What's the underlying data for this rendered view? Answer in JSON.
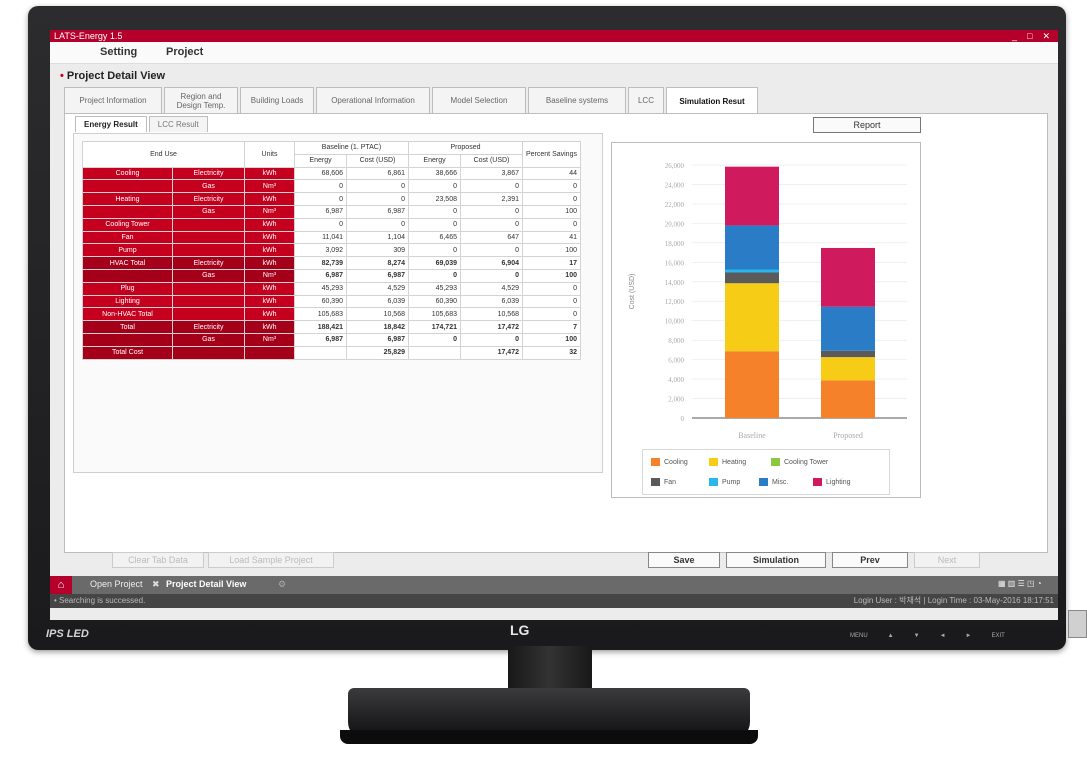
{
  "app": {
    "title": "LATS-Energy 1.5",
    "min": "_",
    "max": "□",
    "close": "✕"
  },
  "menu": [
    "Setting",
    "Project"
  ],
  "page_title": "Project Detail View",
  "tabs": [
    "Project Information",
    "Region and Design Temp.",
    "Building Loads",
    "Operational Information",
    "Model Selection",
    "Baseline systems",
    "LCC",
    "Simulation Resut"
  ],
  "subtabs": [
    "Energy Result",
    "LCC Result"
  ],
  "report_label": "Report",
  "table": {
    "h_enduse": "End Use",
    "h_units": "Units",
    "h_baseline": "Baseline (1. PTAC)",
    "h_proposed": "Proposed",
    "h_percent": "Percent Savings",
    "h_energy": "Energy",
    "h_cost": "Cost (USD)",
    "rows": [
      [
        "Cooling",
        "Electricity",
        "kWh",
        "68,606",
        "6,861",
        "38,666",
        "3,867",
        "44"
      ],
      [
        "",
        "Gas",
        "Nm³",
        "0",
        "0",
        "0",
        "0",
        "0"
      ],
      [
        "Heating",
        "Electricity",
        "kWh",
        "0",
        "0",
        "23,508",
        "2,391",
        "0"
      ],
      [
        "",
        "Gas",
        "Nm³",
        "6,987",
        "6,987",
        "0",
        "0",
        "100"
      ],
      [
        "Cooling Tower",
        "",
        "kWh",
        "0",
        "0",
        "0",
        "0",
        "0"
      ],
      [
        "Fan",
        "",
        "kWh",
        "11,041",
        "1,104",
        "6,465",
        "647",
        "41"
      ],
      [
        "Pump",
        "",
        "kWh",
        "3,092",
        "309",
        "0",
        "0",
        "100"
      ],
      [
        "HVAC Total",
        "Electricity",
        "kWh",
        "82,739",
        "8,274",
        "69,039",
        "6,904",
        "17"
      ],
      [
        "",
        "Gas",
        "Nm³",
        "6,987",
        "6,987",
        "0",
        "0",
        "100"
      ],
      [
        "Plug",
        "",
        "kWh",
        "45,293",
        "4,529",
        "45,293",
        "4,529",
        "0"
      ],
      [
        "Lighting",
        "",
        "kWh",
        "60,390",
        "6,039",
        "60,390",
        "6,039",
        "0"
      ],
      [
        "Non-HVAC Total",
        "",
        "kWh",
        "105,683",
        "10,568",
        "105,683",
        "10,568",
        "0"
      ],
      [
        "Total",
        "Electricity",
        "kWh",
        "188,421",
        "18,842",
        "174,721",
        "17,472",
        "7"
      ],
      [
        "",
        "Gas",
        "Nm³",
        "6,987",
        "6,987",
        "0",
        "0",
        "100"
      ],
      [
        "Total Cost",
        "",
        "",
        "",
        "25,829",
        "",
        "17,472",
        "32"
      ]
    ]
  },
  "chart_data": {
    "type": "bar",
    "stacked": true,
    "categories": [
      "Baseline",
      "Proposed"
    ],
    "ylabel": "Cost (USD)",
    "ylim": [
      0,
      26000
    ],
    "yticks": [
      0,
      2000,
      4000,
      6000,
      8000,
      10000,
      12000,
      14000,
      16000,
      18000,
      20000,
      22000,
      24000,
      26000
    ],
    "ytick_labels": [
      "0",
      "2,000",
      "4,000",
      "6,000",
      "8,000",
      "10,000",
      "12,000",
      "14,000",
      "16,000",
      "18,000",
      "20,000",
      "22,000",
      "24,000",
      "26,000"
    ],
    "series": [
      {
        "name": "Cooling",
        "color": "#f5822a",
        "values": [
          6861,
          3867
        ]
      },
      {
        "name": "Heating",
        "color": "#f7cc17",
        "values": [
          6987,
          2391
        ]
      },
      {
        "name": "Cooling Tower",
        "color": "#8dc63f",
        "values": [
          0,
          0
        ]
      },
      {
        "name": "Fan",
        "color": "#5a5a5a",
        "values": [
          1104,
          647
        ]
      },
      {
        "name": "Pump",
        "color": "#29b6e8",
        "values": [
          309,
          0
        ]
      },
      {
        "name": "Misc.",
        "color": "#2b7cc7",
        "values": [
          4529,
          4529
        ]
      },
      {
        "name": "Lighting",
        "color": "#d01a5e",
        "values": [
          6039,
          6039
        ]
      }
    ]
  },
  "buttons": {
    "clear": "Clear Tab Data",
    "load": "Load Sample Project",
    "save": "Save",
    "simulation": "Simulation",
    "prev": "Prev",
    "next": "Next"
  },
  "taskbar": {
    "open": "Open Project",
    "detail": "Project Detail View"
  },
  "status": {
    "left": "• Searching is successed.",
    "right": "Login User : 박재석 | Login Time : 03-May-2016 18:17:51"
  },
  "monitor": {
    "brand": "LG",
    "led": "IPS LED",
    "osd": [
      "MENU",
      "▲",
      "▼",
      "◄",
      "►",
      "EXIT"
    ]
  }
}
